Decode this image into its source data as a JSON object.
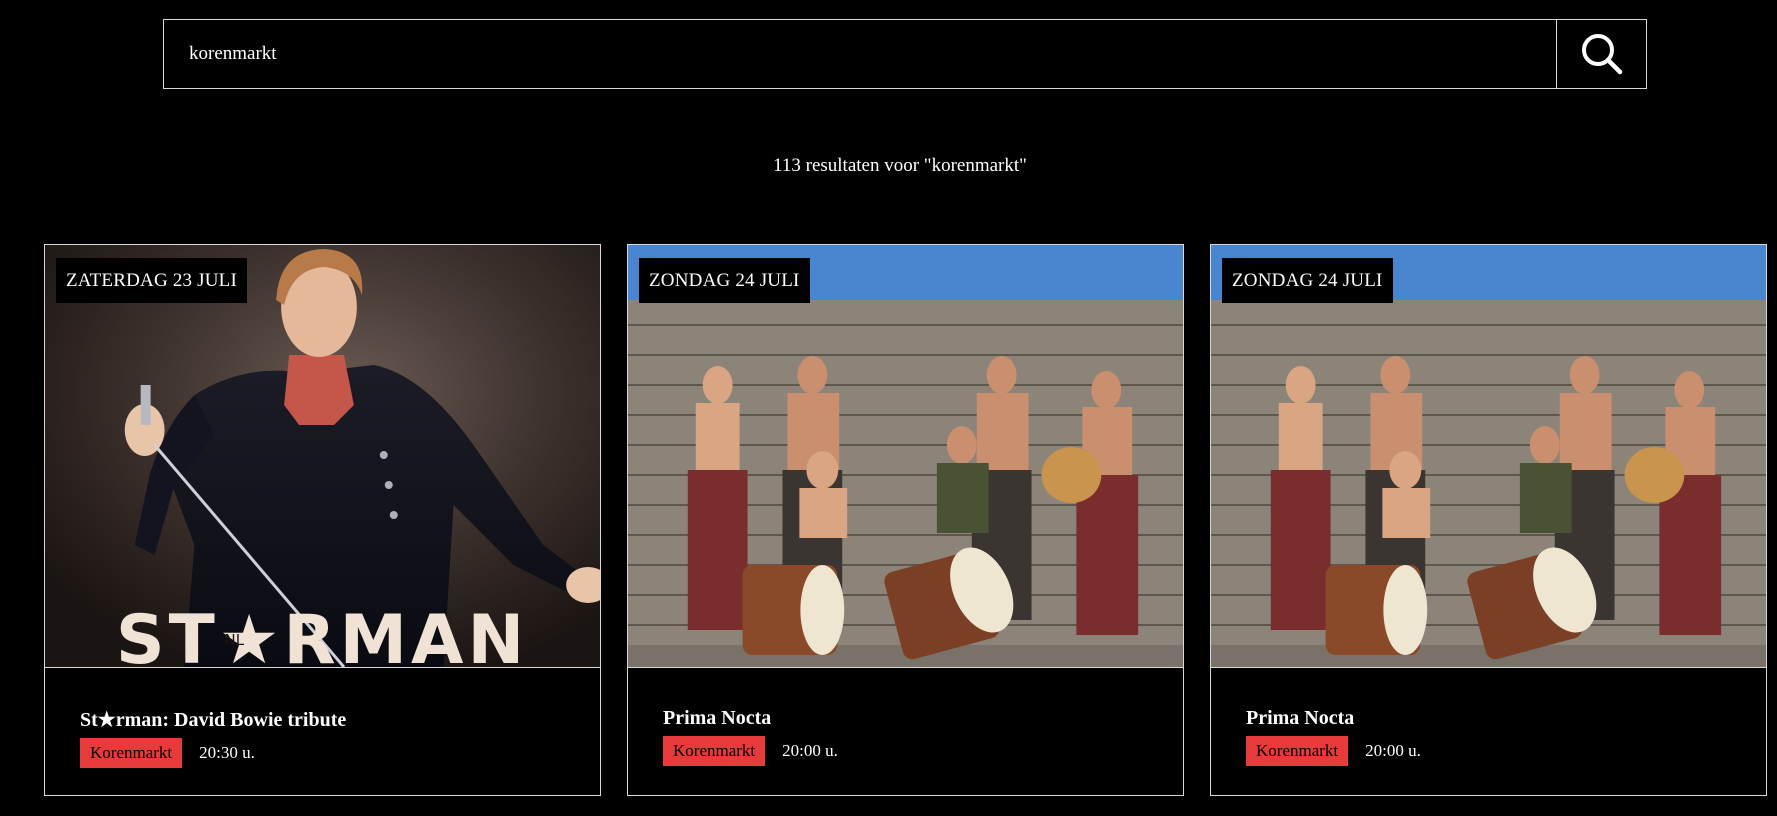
{
  "search": {
    "value": "korenmarkt",
    "icon": "search-icon"
  },
  "results": {
    "summary": "113 resultaten voor \"korenmarkt\""
  },
  "events": [
    {
      "date": "ZATERDAG 23 JULI",
      "title": "St★rman: David Bowie tribute",
      "venue": "Korenmarkt",
      "time": "20:30 u.",
      "poster_text": "ST★RMAN",
      "poster_star_text": "NL"
    },
    {
      "date": "ZONDAG 24 JULI",
      "title": "Prima Nocta",
      "venue": "Korenmarkt",
      "time": "20:00 u."
    },
    {
      "date": "ZONDAG 24 JULI",
      "title": "Prima Nocta",
      "venue": "Korenmarkt",
      "time": "20:00 u."
    }
  ],
  "colors": {
    "background": "#000000",
    "venue_tag": "#e83a3a",
    "border": "#d8d8d8"
  }
}
